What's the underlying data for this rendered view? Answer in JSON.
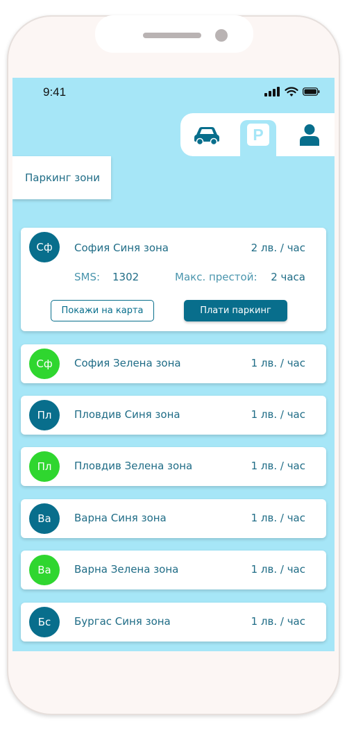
{
  "status_bar": {
    "time": "9:41"
  },
  "nav": {
    "items": [
      {
        "name": "car",
        "icon": "car-icon"
      },
      {
        "name": "parking",
        "icon": "parking-icon",
        "label": "P",
        "active": true
      },
      {
        "name": "profile",
        "icon": "user-icon"
      }
    ]
  },
  "page": {
    "title": "Паркинг зони"
  },
  "expanded_zone": {
    "abbr": "Сф",
    "name": "София Синя зона",
    "price": "2 лв. / час",
    "color": "blue",
    "sms_label": "SMS:",
    "sms_value": "1302",
    "stay_label": "Макс. престой:",
    "stay_value": "2 часа",
    "map_button": "Покажи на карта",
    "pay_button": "Плати паркинг"
  },
  "zones": [
    {
      "abbr": "Сф",
      "name": "София Зелена зона",
      "price": "1 лв. / час",
      "color": "green"
    },
    {
      "abbr": "Пл",
      "name": "Пловдив Синя зона",
      "price": "1 лв. / час",
      "color": "blue"
    },
    {
      "abbr": "Пл",
      "name": "Пловдив Зелена зона",
      "price": "1 лв. / час",
      "color": "green"
    },
    {
      "abbr": "Ва",
      "name": "Варна Синя зона",
      "price": "1 лв. / час",
      "color": "blue"
    },
    {
      "abbr": "Ва",
      "name": "Варна Зелена зона",
      "price": "1 лв. / час",
      "color": "green"
    },
    {
      "abbr": "Бс",
      "name": "Бургас Синя зона",
      "price": "1 лв. / час",
      "color": "blue"
    }
  ],
  "colors": {
    "blue": "#086e8c",
    "green": "#2fd62f",
    "screen_bg": "#a6e6f7",
    "text": "#1f6c86"
  }
}
